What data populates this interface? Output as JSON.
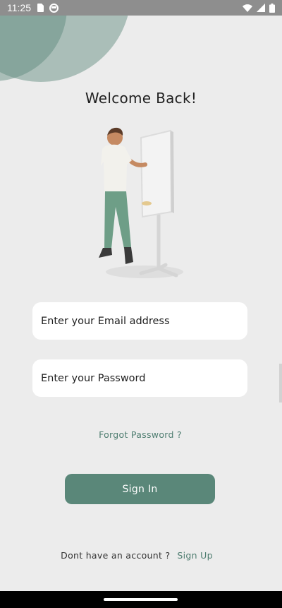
{
  "status_bar": {
    "time": "11:25",
    "left_icons": [
      "sim-card-icon",
      "app-notification-icon"
    ],
    "right_icons": [
      "wifi-icon",
      "signal-icon",
      "battery-icon"
    ]
  },
  "colors": {
    "accent": "#5a8779",
    "link": "#4e7d70",
    "background": "#ececec",
    "field_background": "#ffffff"
  },
  "login": {
    "title": "Welcome Back!",
    "illustration_icon": "person-at-whiteboard-illustration",
    "email_placeholder": "Enter your Email address",
    "password_placeholder": "Enter your Password",
    "forgot_password": "Forgot Password ?",
    "sign_in_label": "Sign In",
    "signup_prompt": "Dont have an account ?",
    "signup_link": "Sign Up"
  }
}
